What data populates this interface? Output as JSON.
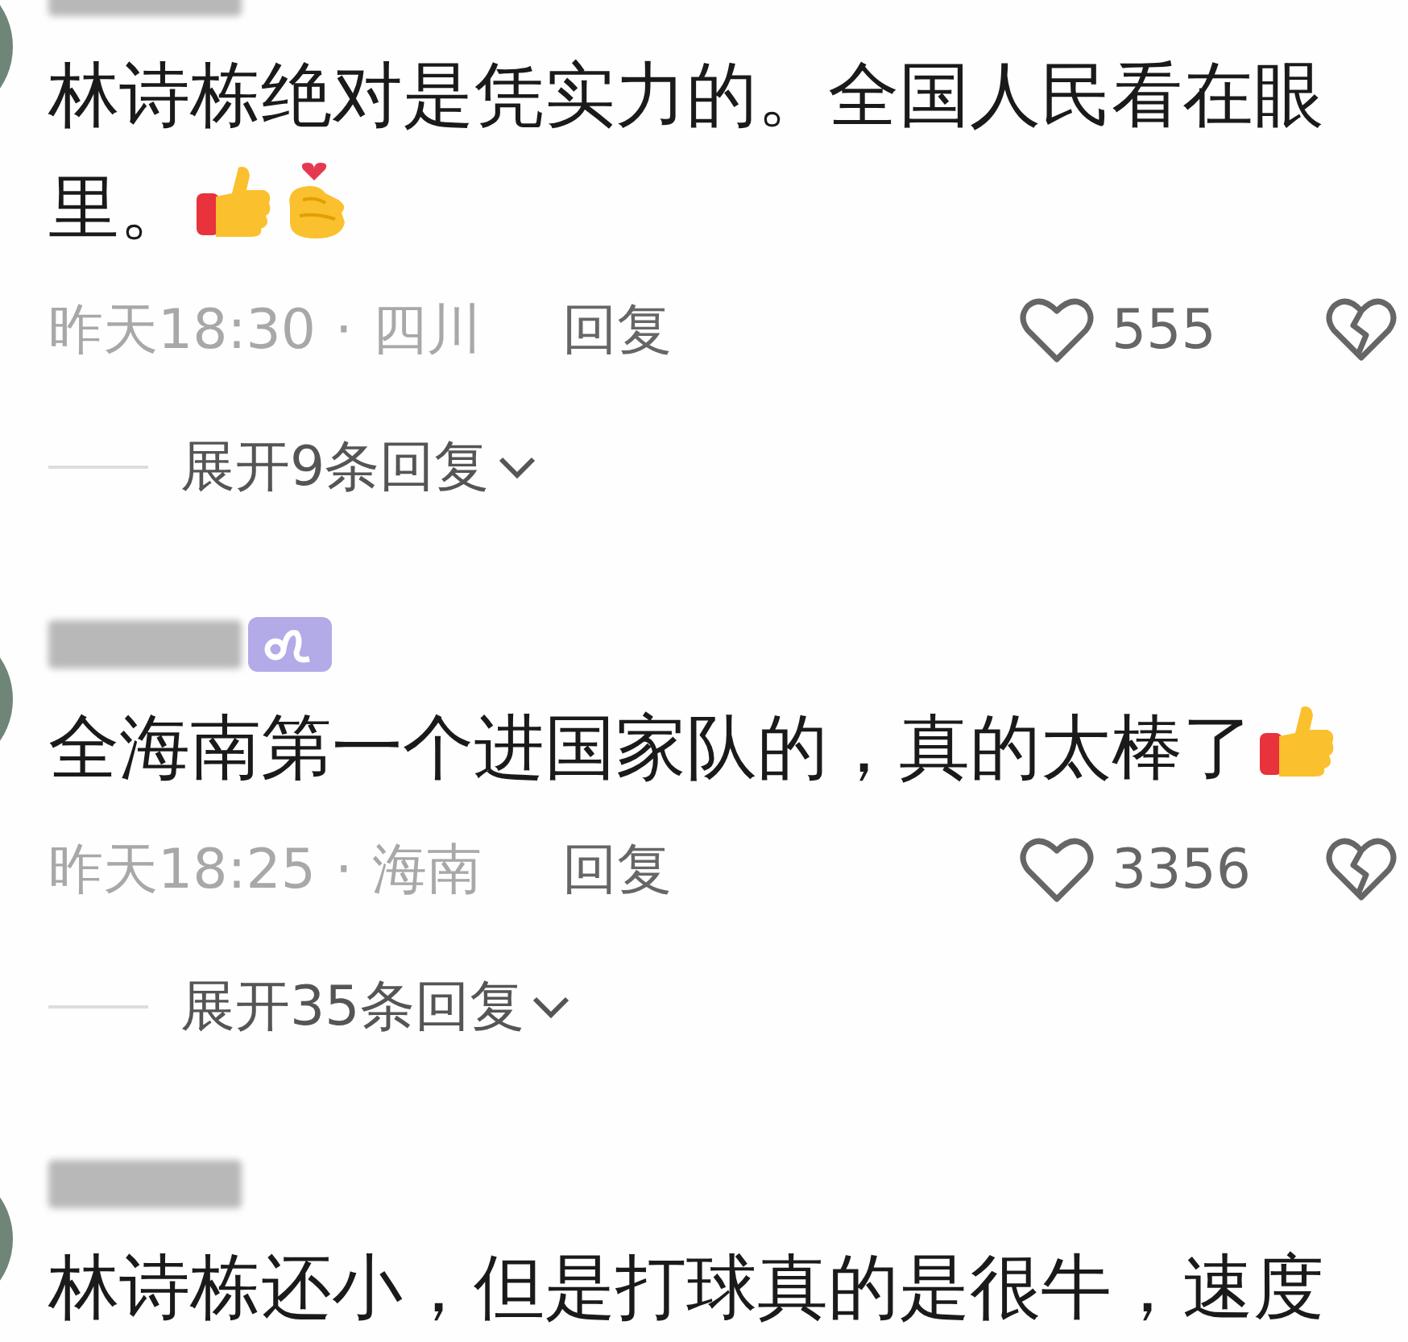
{
  "comments": [
    {
      "badge": false,
      "text": "林诗栋绝对是凭实力的。全国人民看在眼里。",
      "emojis": [
        {
          "kind": "thumbs-up"
        },
        {
          "kind": "finger-heart"
        }
      ],
      "meta": {
        "time": "昨天18:30",
        "separator": "·",
        "location": "四川",
        "reply": "回复",
        "likes": "555"
      },
      "expand": "展开9条回复"
    },
    {
      "badge": true,
      "text": "全海南第一个进国家队的，真的太棒了",
      "emojis": [
        {
          "kind": "thumbs-up"
        }
      ],
      "meta": {
        "time": "昨天18:25",
        "separator": "·",
        "location": "海南",
        "reply": "回复",
        "likes": "3356"
      },
      "expand": "展开35条回复"
    },
    {
      "badge": false,
      "text": "林诗栋还小，但是打球真的是很牛，速度"
    }
  ]
}
